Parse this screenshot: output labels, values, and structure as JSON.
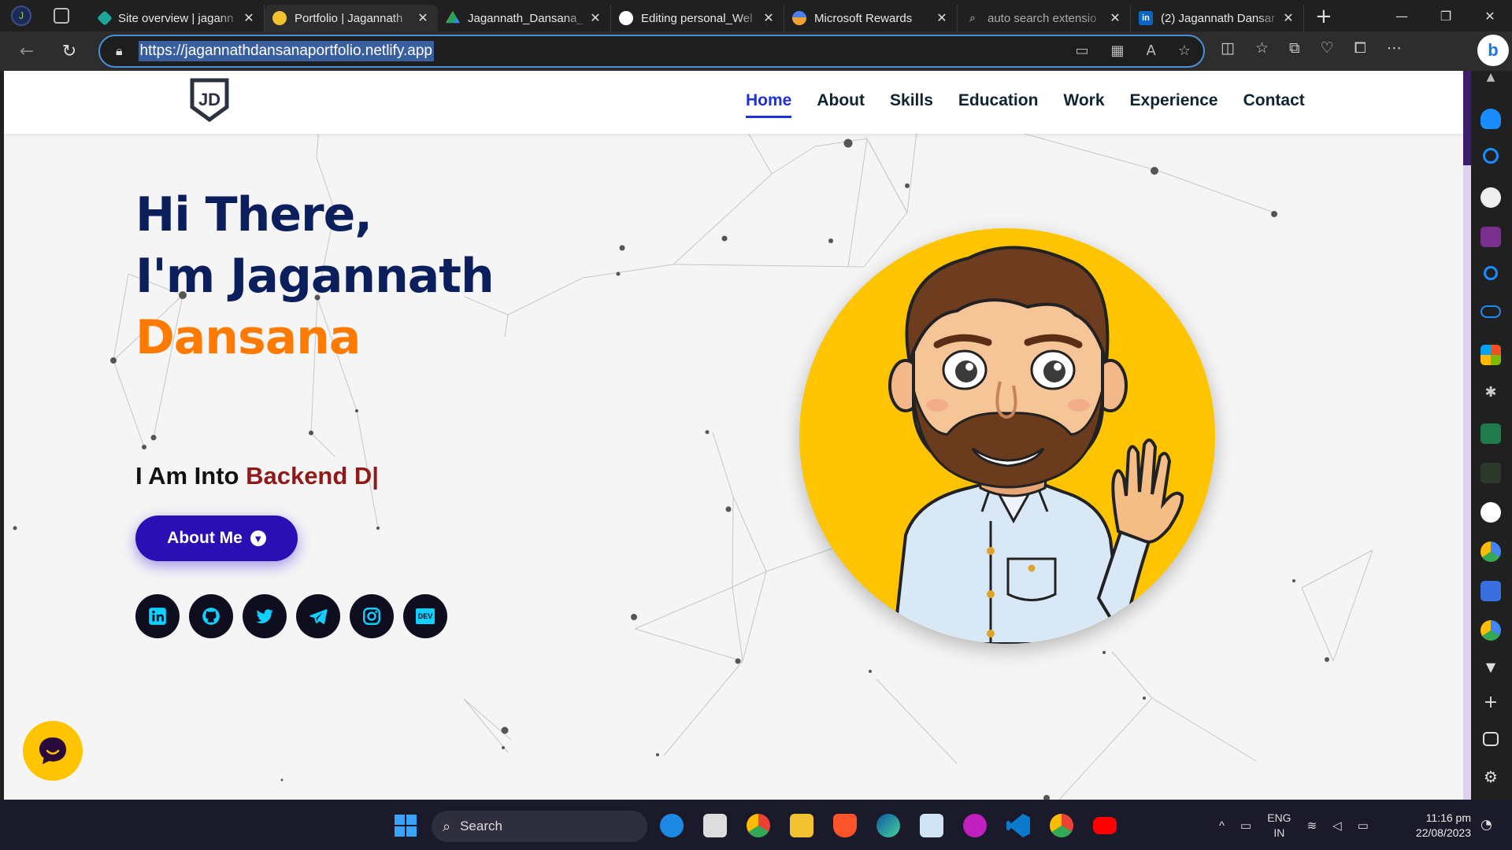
{
  "browser": {
    "profile_initial": "J",
    "tabs": [
      {
        "title": "Site overview | jagann",
        "favicon_color": "#1ea59a"
      },
      {
        "title": "Portfolio | Jagannath",
        "favicon_color": "#f2c12e",
        "active": true
      },
      {
        "title": "Jagannath_Dansana_",
        "favicon_color": "#1fa463"
      },
      {
        "title": "Editing personal_Wel",
        "favicon_color": "#ffffff"
      },
      {
        "title": "Microsoft Rewards",
        "favicon_color": "#4d7ef0"
      },
      {
        "title": "auto search extensio",
        "favicon_color": "#5b5b5b"
      },
      {
        "title": "(2) Jagannath Dansar",
        "favicon_color": "#0a66c2"
      }
    ],
    "address": "https://jagannathdansanaportfolio.netlify.app"
  },
  "site": {
    "logo_text": "JD",
    "nav": [
      "Home",
      "About",
      "Skills",
      "Education",
      "Work",
      "Experience",
      "Contact"
    ],
    "hero": {
      "line1": "Hi There,",
      "line2": "I'm Jagannath",
      "line3": "Dansana",
      "typing_prefix": "I Am Into",
      "typing_text": "Backend D|",
      "button_label": "About Me"
    },
    "socials": [
      "linkedin-icon",
      "github-icon",
      "twitter-icon",
      "telegram-icon",
      "instagram-icon",
      "dev-icon"
    ],
    "dev_label": "DEV"
  },
  "taskbar": {
    "search_placeholder": "Search",
    "lang_top": "ENG",
    "lang_bottom": "IN",
    "time": "11:16 pm",
    "date": "22/08/2023"
  },
  "colors": {
    "accent": "#2a0fb5",
    "hero_name": "#ff7a00",
    "heading": "#0b1f5c",
    "typed_text": "#901a1a",
    "avatar_bg": "#ffc400"
  }
}
